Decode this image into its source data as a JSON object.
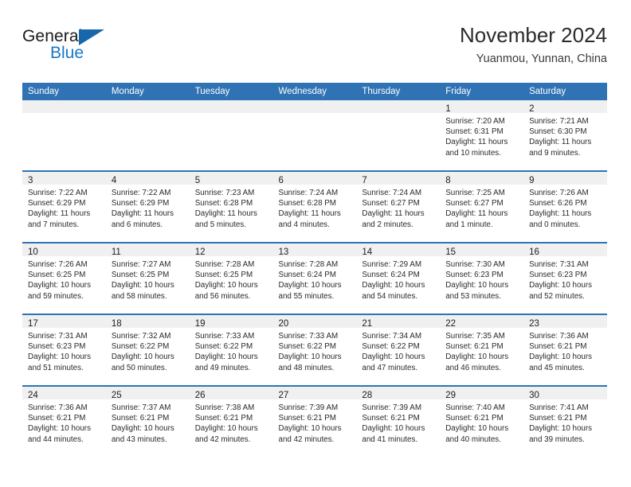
{
  "brand": {
    "name_top": "General",
    "name_bottom": "Blue",
    "accent_dark": "#1767ab",
    "accent_blue": "#1878c8"
  },
  "header": {
    "title": "November 2024",
    "subtitle": "Yuanmou, Yunnan, China"
  },
  "theme": {
    "header_blue": "#3073b4",
    "daynum_band": "#f0f0f0",
    "text": "#2a2a2a"
  },
  "columns": [
    "Sunday",
    "Monday",
    "Tuesday",
    "Wednesday",
    "Thursday",
    "Friday",
    "Saturday"
  ],
  "weeks": [
    [
      {
        "day": "",
        "sunrise": "",
        "sunset": "",
        "daylight1": "",
        "daylight2": "",
        "empty": true
      },
      {
        "day": "",
        "sunrise": "",
        "sunset": "",
        "daylight1": "",
        "daylight2": "",
        "empty": true
      },
      {
        "day": "",
        "sunrise": "",
        "sunset": "",
        "daylight1": "",
        "daylight2": "",
        "empty": true
      },
      {
        "day": "",
        "sunrise": "",
        "sunset": "",
        "daylight1": "",
        "daylight2": "",
        "empty": true
      },
      {
        "day": "",
        "sunrise": "",
        "sunset": "",
        "daylight1": "",
        "daylight2": "",
        "empty": true
      },
      {
        "day": "1",
        "sunrise": "Sunrise: 7:20 AM",
        "sunset": "Sunset: 6:31 PM",
        "daylight1": "Daylight: 11 hours",
        "daylight2": "and 10 minutes."
      },
      {
        "day": "2",
        "sunrise": "Sunrise: 7:21 AM",
        "sunset": "Sunset: 6:30 PM",
        "daylight1": "Daylight: 11 hours",
        "daylight2": "and 9 minutes."
      }
    ],
    [
      {
        "day": "3",
        "sunrise": "Sunrise: 7:22 AM",
        "sunset": "Sunset: 6:29 PM",
        "daylight1": "Daylight: 11 hours",
        "daylight2": "and 7 minutes."
      },
      {
        "day": "4",
        "sunrise": "Sunrise: 7:22 AM",
        "sunset": "Sunset: 6:29 PM",
        "daylight1": "Daylight: 11 hours",
        "daylight2": "and 6 minutes."
      },
      {
        "day": "5",
        "sunrise": "Sunrise: 7:23 AM",
        "sunset": "Sunset: 6:28 PM",
        "daylight1": "Daylight: 11 hours",
        "daylight2": "and 5 minutes."
      },
      {
        "day": "6",
        "sunrise": "Sunrise: 7:24 AM",
        "sunset": "Sunset: 6:28 PM",
        "daylight1": "Daylight: 11 hours",
        "daylight2": "and 4 minutes."
      },
      {
        "day": "7",
        "sunrise": "Sunrise: 7:24 AM",
        "sunset": "Sunset: 6:27 PM",
        "daylight1": "Daylight: 11 hours",
        "daylight2": "and 2 minutes."
      },
      {
        "day": "8",
        "sunrise": "Sunrise: 7:25 AM",
        "sunset": "Sunset: 6:27 PM",
        "daylight1": "Daylight: 11 hours",
        "daylight2": "and 1 minute."
      },
      {
        "day": "9",
        "sunrise": "Sunrise: 7:26 AM",
        "sunset": "Sunset: 6:26 PM",
        "daylight1": "Daylight: 11 hours",
        "daylight2": "and 0 minutes."
      }
    ],
    [
      {
        "day": "10",
        "sunrise": "Sunrise: 7:26 AM",
        "sunset": "Sunset: 6:25 PM",
        "daylight1": "Daylight: 10 hours",
        "daylight2": "and 59 minutes."
      },
      {
        "day": "11",
        "sunrise": "Sunrise: 7:27 AM",
        "sunset": "Sunset: 6:25 PM",
        "daylight1": "Daylight: 10 hours",
        "daylight2": "and 58 minutes."
      },
      {
        "day": "12",
        "sunrise": "Sunrise: 7:28 AM",
        "sunset": "Sunset: 6:25 PM",
        "daylight1": "Daylight: 10 hours",
        "daylight2": "and 56 minutes."
      },
      {
        "day": "13",
        "sunrise": "Sunrise: 7:28 AM",
        "sunset": "Sunset: 6:24 PM",
        "daylight1": "Daylight: 10 hours",
        "daylight2": "and 55 minutes."
      },
      {
        "day": "14",
        "sunrise": "Sunrise: 7:29 AM",
        "sunset": "Sunset: 6:24 PM",
        "daylight1": "Daylight: 10 hours",
        "daylight2": "and 54 minutes."
      },
      {
        "day": "15",
        "sunrise": "Sunrise: 7:30 AM",
        "sunset": "Sunset: 6:23 PM",
        "daylight1": "Daylight: 10 hours",
        "daylight2": "and 53 minutes."
      },
      {
        "day": "16",
        "sunrise": "Sunrise: 7:31 AM",
        "sunset": "Sunset: 6:23 PM",
        "daylight1": "Daylight: 10 hours",
        "daylight2": "and 52 minutes."
      }
    ],
    [
      {
        "day": "17",
        "sunrise": "Sunrise: 7:31 AM",
        "sunset": "Sunset: 6:23 PM",
        "daylight1": "Daylight: 10 hours",
        "daylight2": "and 51 minutes."
      },
      {
        "day": "18",
        "sunrise": "Sunrise: 7:32 AM",
        "sunset": "Sunset: 6:22 PM",
        "daylight1": "Daylight: 10 hours",
        "daylight2": "and 50 minutes."
      },
      {
        "day": "19",
        "sunrise": "Sunrise: 7:33 AM",
        "sunset": "Sunset: 6:22 PM",
        "daylight1": "Daylight: 10 hours",
        "daylight2": "and 49 minutes."
      },
      {
        "day": "20",
        "sunrise": "Sunrise: 7:33 AM",
        "sunset": "Sunset: 6:22 PM",
        "daylight1": "Daylight: 10 hours",
        "daylight2": "and 48 minutes."
      },
      {
        "day": "21",
        "sunrise": "Sunrise: 7:34 AM",
        "sunset": "Sunset: 6:22 PM",
        "daylight1": "Daylight: 10 hours",
        "daylight2": "and 47 minutes."
      },
      {
        "day": "22",
        "sunrise": "Sunrise: 7:35 AM",
        "sunset": "Sunset: 6:21 PM",
        "daylight1": "Daylight: 10 hours",
        "daylight2": "and 46 minutes."
      },
      {
        "day": "23",
        "sunrise": "Sunrise: 7:36 AM",
        "sunset": "Sunset: 6:21 PM",
        "daylight1": "Daylight: 10 hours",
        "daylight2": "and 45 minutes."
      }
    ],
    [
      {
        "day": "24",
        "sunrise": "Sunrise: 7:36 AM",
        "sunset": "Sunset: 6:21 PM",
        "daylight1": "Daylight: 10 hours",
        "daylight2": "and 44 minutes."
      },
      {
        "day": "25",
        "sunrise": "Sunrise: 7:37 AM",
        "sunset": "Sunset: 6:21 PM",
        "daylight1": "Daylight: 10 hours",
        "daylight2": "and 43 minutes."
      },
      {
        "day": "26",
        "sunrise": "Sunrise: 7:38 AM",
        "sunset": "Sunset: 6:21 PM",
        "daylight1": "Daylight: 10 hours",
        "daylight2": "and 42 minutes."
      },
      {
        "day": "27",
        "sunrise": "Sunrise: 7:39 AM",
        "sunset": "Sunset: 6:21 PM",
        "daylight1": "Daylight: 10 hours",
        "daylight2": "and 42 minutes."
      },
      {
        "day": "28",
        "sunrise": "Sunrise: 7:39 AM",
        "sunset": "Sunset: 6:21 PM",
        "daylight1": "Daylight: 10 hours",
        "daylight2": "and 41 minutes."
      },
      {
        "day": "29",
        "sunrise": "Sunrise: 7:40 AM",
        "sunset": "Sunset: 6:21 PM",
        "daylight1": "Daylight: 10 hours",
        "daylight2": "and 40 minutes."
      },
      {
        "day": "30",
        "sunrise": "Sunrise: 7:41 AM",
        "sunset": "Sunset: 6:21 PM",
        "daylight1": "Daylight: 10 hours",
        "daylight2": "and 39 minutes."
      }
    ]
  ]
}
